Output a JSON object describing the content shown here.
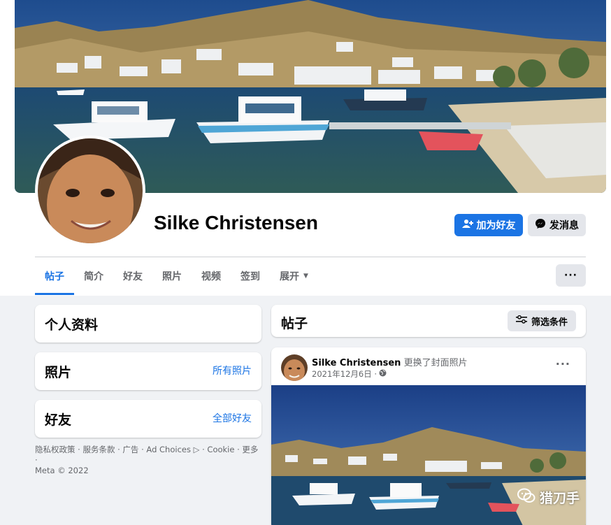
{
  "profile": {
    "name": "Silke Christensen"
  },
  "actions": {
    "add_friend": "加为好友",
    "message": "发消息"
  },
  "tabs": [
    {
      "label": "帖子",
      "active": true
    },
    {
      "label": "简介"
    },
    {
      "label": "好友"
    },
    {
      "label": "照片"
    },
    {
      "label": "视频"
    },
    {
      "label": "签到"
    },
    {
      "label": "展开"
    }
  ],
  "more_label": "···",
  "sidebar": {
    "intro_title": "个人资料",
    "photos_title": "照片",
    "photos_link": "所有照片",
    "friends_title": "好友",
    "friends_link": "全部好友"
  },
  "footer": {
    "line1": "隐私权政策 · 服务条款 · 广告 · Ad Choices ▷ · Cookie · 更多 ·",
    "line2": "Meta © 2022"
  },
  "posts_header": {
    "title": "帖子",
    "filter_label": "筛选条件"
  },
  "post": {
    "author": "Silke Christensen",
    "action": "更换了封面照片",
    "date": "2021年12月6日 ·",
    "dots": "···"
  },
  "watermark": "猎刀手",
  "colors": {
    "accent": "#1b74e4",
    "secondary_button": "#e4e6eb",
    "page_bg": "#f0f2f5"
  }
}
